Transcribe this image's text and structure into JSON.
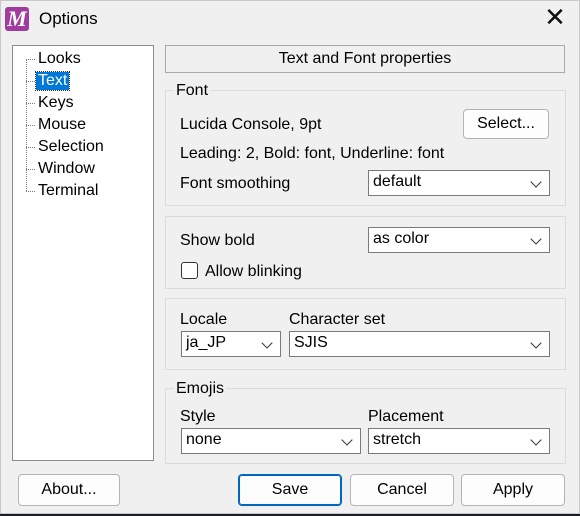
{
  "window": {
    "title": "Options",
    "app_icon_letter": "M"
  },
  "tree": {
    "items": [
      "Looks",
      "Text",
      "Keys",
      "Mouse",
      "Selection",
      "Window",
      "Terminal"
    ],
    "selected": "Text"
  },
  "panel": {
    "header": "Text and Font properties",
    "font_group": {
      "label": "Font",
      "font_name": "Lucida Console, 9pt",
      "select_button": "Select...",
      "info": "Leading: 2, Bold: font, Underline: font",
      "smoothing_label": "Font smoothing",
      "smoothing_value": "default"
    },
    "bold_group": {
      "show_bold_label": "Show bold",
      "show_bold_value": "as color",
      "allow_blinking_label": "Allow blinking",
      "allow_blinking_checked": false
    },
    "locale_group": {
      "locale_label": "Locale",
      "locale_value": "ja_JP",
      "charset_label": "Character set",
      "charset_value": "SJIS"
    },
    "emojis_group": {
      "label": "Emojis",
      "style_label": "Style",
      "style_value": "none",
      "placement_label": "Placement",
      "placement_value": "stretch"
    }
  },
  "buttons": {
    "about": "About...",
    "save": "Save",
    "cancel": "Cancel",
    "apply": "Apply"
  },
  "colors": {
    "selection": "#0078d7",
    "app_icon": "#a03ca0",
    "window_bg": "#f0f0f0"
  }
}
